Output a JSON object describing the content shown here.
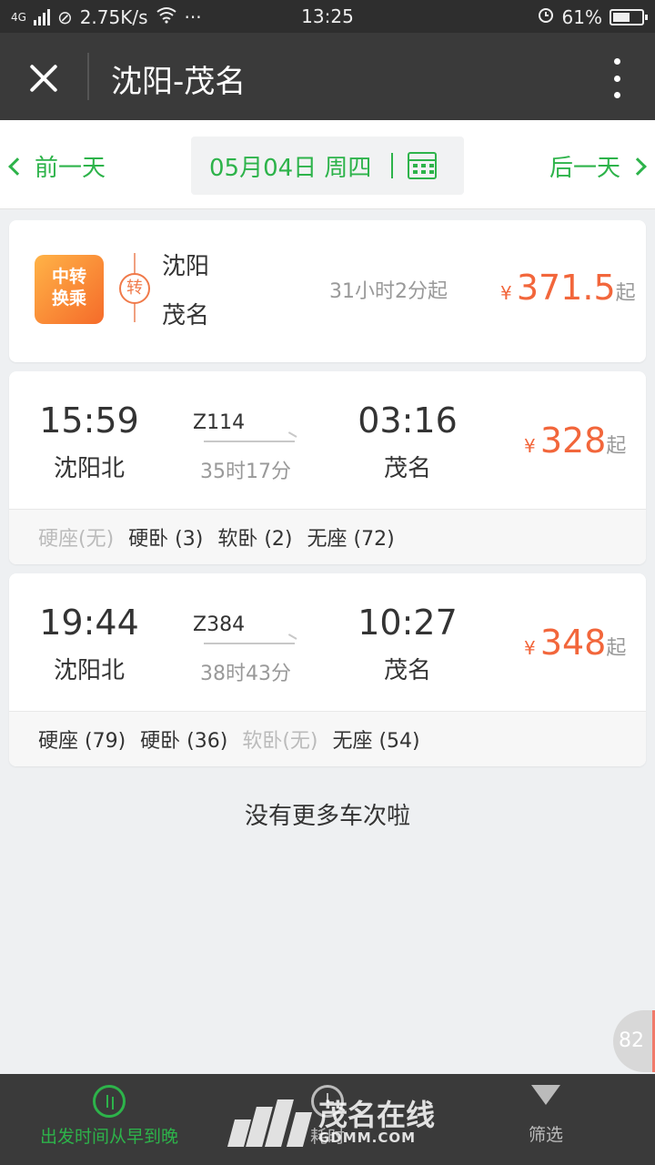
{
  "status_bar": {
    "network": "4G",
    "speed": "2.75K/s",
    "dots": "···",
    "time": "13:25",
    "battery": "61%",
    "battery_level": 0.61
  },
  "title_bar": {
    "title": "沈阳-茂名"
  },
  "date_bar": {
    "prev_label": "前一天",
    "date_label": "05月04日 周四",
    "next_label": "后一天"
  },
  "transfer_card": {
    "logo_line1": "中转",
    "logo_line2": "换乘",
    "badge": "转",
    "from": "沈阳",
    "to": "茂名",
    "duration": "31小时2分起",
    "currency": "¥",
    "price": "371.5",
    "price_suffix": "起"
  },
  "trains": [
    {
      "dep_time": "15:59",
      "dep_station": "沈阳北",
      "train_no": "Z114",
      "duration": "35时17分",
      "arr_time": "03:16",
      "arr_station": "茂名",
      "currency": "¥",
      "price": "328",
      "price_suffix": "起",
      "seats": [
        {
          "label": "硬座(无)",
          "available": false
        },
        {
          "label": "硬卧 (3)",
          "available": true
        },
        {
          "label": "软卧 (2)",
          "available": true
        },
        {
          "label": "无座 (72)",
          "available": true
        }
      ]
    },
    {
      "dep_time": "19:44",
      "dep_station": "沈阳北",
      "train_no": "Z384",
      "duration": "38时43分",
      "arr_time": "10:27",
      "arr_station": "茂名",
      "currency": "¥",
      "price": "348",
      "price_suffix": "起",
      "seats": [
        {
          "label": "硬座 (79)",
          "available": true
        },
        {
          "label": "硬卧 (36)",
          "available": true
        },
        {
          "label": "软卧(无)",
          "available": false
        },
        {
          "label": "无座 (54)",
          "available": true
        }
      ]
    }
  ],
  "no_more": "没有更多车次啦",
  "float_badge": "82",
  "bottom_bar": {
    "sort_label": "出发时间从早到晚",
    "time_label": "耗时",
    "filter_label": "筛选"
  },
  "watermark": {
    "text": "茂名在线",
    "sub": "GDMM.COM"
  },
  "colors": {
    "accent_green": "#2db34a",
    "price_orange": "#f2663b",
    "header_dark": "#3a3a3a"
  }
}
